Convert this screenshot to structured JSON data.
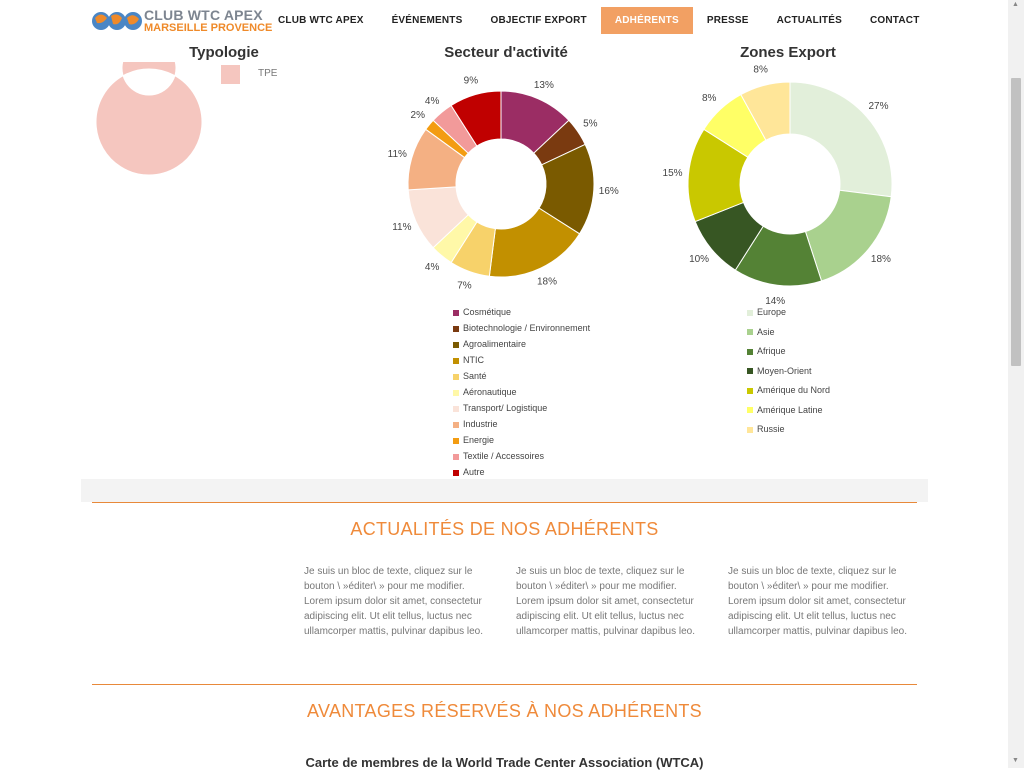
{
  "header": {
    "logo_line1": "CLUB WTC APEX",
    "logo_line2": "MARSEILLE PROVENCE",
    "nav": [
      {
        "label": "CLUB WTC APEX"
      },
      {
        "label": "ÉVÉNEMENTS"
      },
      {
        "label": "OBJECTIF EXPORT"
      },
      {
        "label": "ADHÉRENTS",
        "active": true
      },
      {
        "label": "PRESSE"
      },
      {
        "label": "ACTUALITÉS"
      },
      {
        "label": "CONTACT"
      }
    ]
  },
  "colors": {
    "accent": "#ef8a3a",
    "active_nav": "#f2a063"
  },
  "chart_data": [
    {
      "type": "pie",
      "title": "Typologie",
      "categories": [
        "TPE"
      ],
      "values": [
        100
      ],
      "colors": [
        "#f5c6bf"
      ]
    },
    {
      "type": "pie",
      "title": "Secteur d'activité",
      "categories": [
        "Cosmétique",
        "Biotechnologie / Environnement",
        "Agroalimentaire",
        "NTIC",
        "Santé",
        "Aéronautique",
        "Transport/ Logistique",
        "Industrie",
        "Energie",
        "Textile / Accessoires",
        "Autre"
      ],
      "values": [
        13,
        5,
        16,
        18,
        7,
        4,
        11,
        11,
        2,
        4,
        9
      ],
      "labels": [
        "13%",
        "5%",
        "16%",
        "18%",
        "7%",
        "4%",
        "11%",
        "11%",
        "2%",
        "4%",
        "9%"
      ],
      "colors": [
        "#9b2d64",
        "#7a3a10",
        "#7a5a00",
        "#c29000",
        "#f7d26a",
        "#fff8a8",
        "#fae3d9",
        "#f4b083",
        "#f39c12",
        "#f29a9a",
        "#c00000"
      ]
    },
    {
      "type": "pie",
      "title": "Zones Export",
      "categories": [
        "Europe",
        "Asie",
        "Afrique",
        "Moyen-Orient",
        "Amérique du Nord",
        "Amérique Latine",
        "Russie"
      ],
      "values": [
        27,
        18,
        14,
        10,
        15,
        8,
        8
      ],
      "labels": [
        "27%",
        "18%",
        "14%",
        "10%",
        "15%",
        "8%",
        "8%"
      ],
      "colors": [
        "#e2efda",
        "#a9d18e",
        "#548235",
        "#375623",
        "#c9c800",
        "#ffff66",
        "#ffe699"
      ]
    }
  ],
  "news": {
    "title": "ACTUALITÉS DE NOS ADHÉRENTS",
    "items": [
      {
        "text": "Je suis un bloc de texte, cliquez sur le bouton \\ »éditer\\ » pour me modifier. Lorem ipsum dolor sit amet, consectetur adipiscing elit. Ut elit tellus, luctus nec ullamcorper mattis, pulvinar dapibus leo."
      },
      {
        "text": "Je suis un bloc de texte, cliquez sur le bouton \\ »éditer\\ » pour me modifier. Lorem ipsum dolor sit amet, consectetur adipiscing elit. Ut elit tellus, luctus nec ullamcorper mattis, pulvinar dapibus leo."
      },
      {
        "text": "Je suis un bloc de texte, cliquez sur le bouton \\ »éditer\\ » pour me modifier. Lorem ipsum dolor sit amet, consectetur adipiscing elit. Ut elit tellus, luctus nec ullamcorper mattis, pulvinar dapibus leo."
      }
    ]
  },
  "benefits": {
    "title": "AVANTAGES RÉSERVÉS À NOS ADHÉRENTS",
    "first_item": "Carte de membres de la World Trade Center Association (WTCA)"
  }
}
